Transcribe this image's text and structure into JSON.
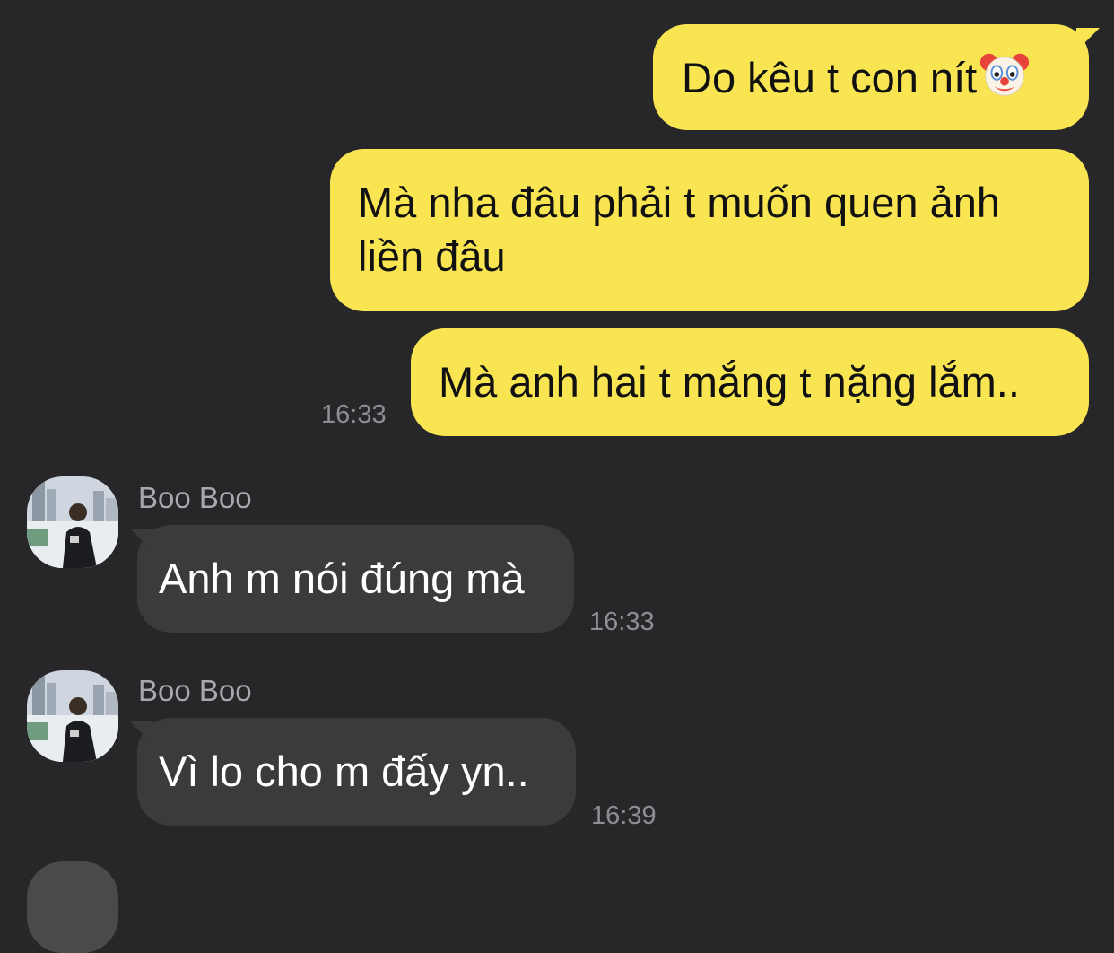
{
  "messages_out": [
    {
      "text": "Do kêu t con nít",
      "emoji": "clown-face"
    },
    {
      "line1": "Mà nha đâu phải t muốn quen ảnh",
      "line2": "liền đâu"
    },
    {
      "text": "Mà anh hai t mắng t nặng lắm..",
      "time": "16:33"
    }
  ],
  "messages_in": [
    {
      "sender": "Boo Boo",
      "text": "Anh m nói đúng mà",
      "time": "16:33"
    },
    {
      "sender": "Boo Boo",
      "text": "Vì lo cho m đấy yn..",
      "time": "16:39"
    }
  ],
  "colors": {
    "background": "#272729",
    "outgoing_bubble": "#f9e552",
    "incoming_bubble": "#3b3b3d",
    "timestamp": "#8e8e92"
  }
}
